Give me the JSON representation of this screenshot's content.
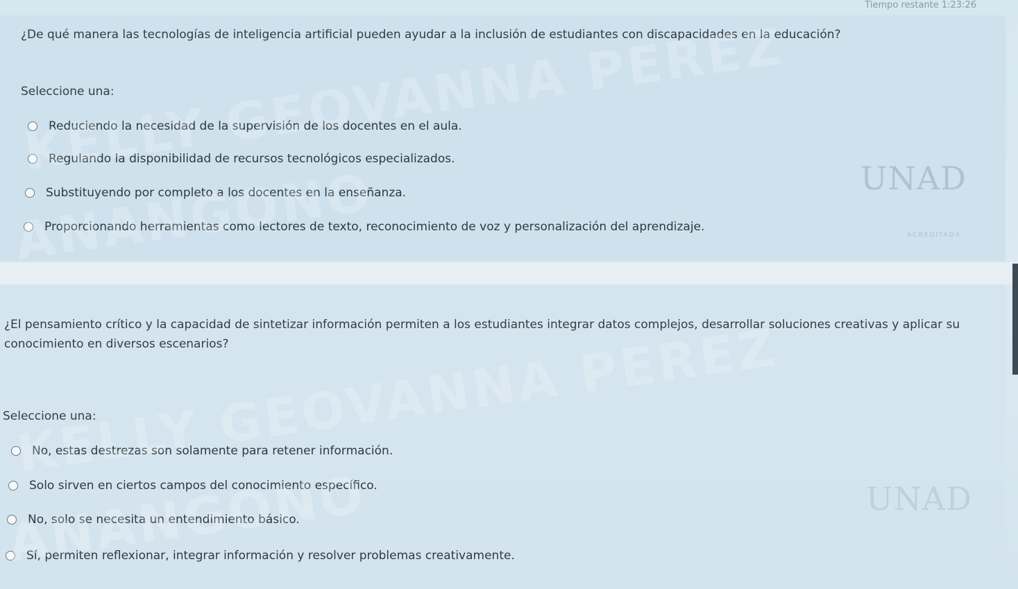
{
  "header": {
    "timer": "Tiempo restante 1:23:26"
  },
  "questions": [
    {
      "text": "¿De qué manera las tecnologías de inteligencia artificial pueden ayudar a la inclusión de estudiantes con discapacidades en la educación?",
      "prompt": "Seleccione una:",
      "options": [
        "Reduciendo la necesidad de la supervisión de los docentes en el aula.",
        "Regulando la disponibilidad de recursos tecnológicos especializados.",
        "Substituyendo por completo a los docentes en la enseñanza.",
        "Proporcionando herramientas como lectores de texto, reconocimiento de voz y personalización del aprendizaje."
      ]
    },
    {
      "text": "¿El pensamiento crítico y la capacidad de sintetizar información permiten a los estudiantes integrar datos complejos, desarrollar soluciones creativas y aplicar su conocimiento en diversos escenarios?",
      "prompt": "Seleccione una:",
      "options": [
        "No, estas destrezas son solamente para retener información.",
        "Solo sirven en ciertos campos del conocimiento específico.",
        "No, solo se necesita un entendimiento básico.",
        "Sí, permiten reflexionar, integrar información y resolver problemas creativamente."
      ]
    }
  ],
  "watermark": {
    "line1": "KELLY GEOVANNA PEREZ",
    "line2": "ANANGONO"
  },
  "logo": {
    "text": "UNAD",
    "sub": "ACREDITADA"
  }
}
